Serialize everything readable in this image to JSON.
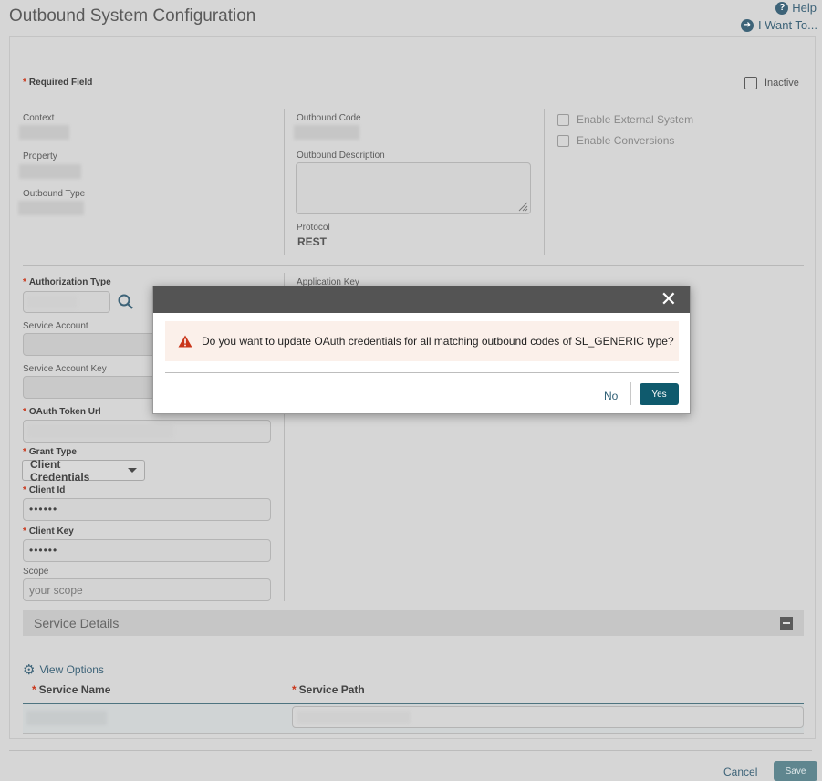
{
  "header": {
    "title": "Outbound System Configuration",
    "help_label": "Help",
    "iwant_label": "I Want To..."
  },
  "form": {
    "required_note": "Required Field",
    "inactive_label": "Inactive",
    "context_label": "Context",
    "property_label": "Property",
    "outbound_type_label": "Outbound Type",
    "outbound_code_label": "Outbound Code",
    "outbound_description_label": "Outbound Description",
    "protocol_label": "Protocol",
    "protocol_value": "REST",
    "enable_external_label": "Enable External System",
    "enable_conversions_label": "Enable Conversions",
    "authorization_type_label": "Authorization Type",
    "application_key_label": "Application Key",
    "service_account_label": "Service Account",
    "service_account_key_label": "Service Account Key",
    "oauth_token_url_label": "OAuth Token Url",
    "grant_type_label": "Grant Type",
    "grant_type_value": "Client Credentials",
    "client_id_label": "Client Id",
    "client_id_value": "••••••",
    "client_key_label": "Client Key",
    "client_key_value": "••••••",
    "scope_label": "Scope",
    "scope_placeholder": "your scope"
  },
  "service_details": {
    "title": "Service Details",
    "view_options": "View Options",
    "col_service_name": "Service Name",
    "col_service_path": "Service Path"
  },
  "footer": {
    "cancel": "Cancel",
    "save": "Save"
  },
  "dialog": {
    "message": "Do you want to update OAuth credentials for all matching outbound codes of SL_GENERIC type?",
    "no": "No",
    "yes": "Yes"
  },
  "icons": {
    "help": "help-icon",
    "arrow": "arrow-right-icon",
    "search": "search-icon",
    "gear": "gear-icon",
    "warning": "warning-icon",
    "close": "close-icon"
  }
}
